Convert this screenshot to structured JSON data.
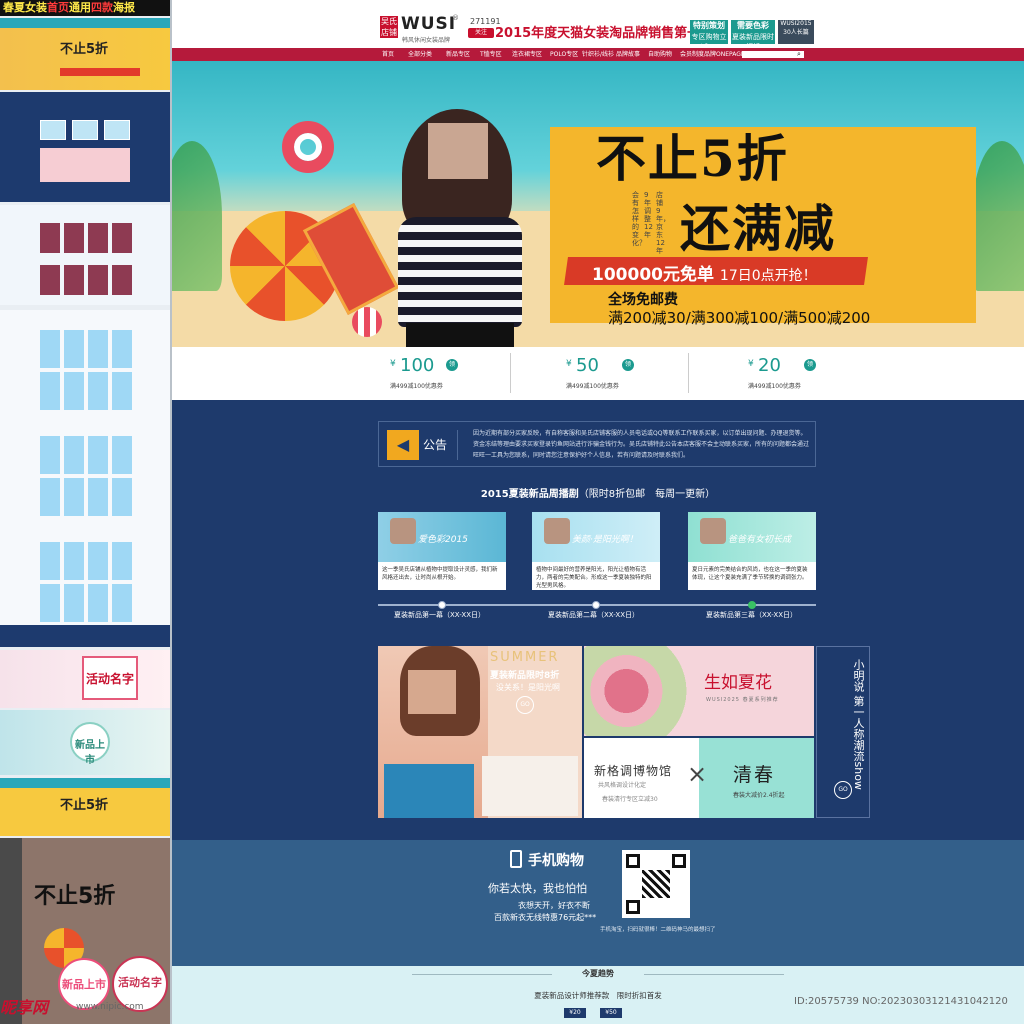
{
  "left_panel": {
    "title_parts": [
      "春夏女装",
      "首页",
      "通用",
      "四款",
      "海报"
    ],
    "hero_text": "不止5折",
    "promo1_label": "活动名字",
    "promo2_label": "新品上市",
    "ps_text": "不止5折",
    "ps_circle1": "新品上市",
    "ps_circle2": "活动名字"
  },
  "header": {
    "logo_badge": "吴氏店铺",
    "logo_text": "WUSI",
    "logo_sub": "韩风休闲女装品牌",
    "fav_count": "271191",
    "fav_button": "关注",
    "slogan": "2015年度天猫女装淘品牌销售第一",
    "box1_title": "特别策划",
    "box1_sub": "专区购物立减10",
    "box2_title": "需要色彩",
    "box2_sub": "夏装新品限时打折",
    "box3": "WUSI2015 30人长篇"
  },
  "nav": {
    "items": [
      "首页",
      "全部分类",
      "新品专区",
      "T恤专区",
      "连衣裙专区",
      "POLO专区",
      "针织衫/线衫",
      "品牌故事",
      "自助购物",
      "会员制度",
      "品牌ONEPAGE"
    ]
  },
  "hero": {
    "title1": "不止5折",
    "title2": "还满减",
    "vert1": "店铺9年，京东12年",
    "vert2": "9年调整12年",
    "vert3": "会有怎样的变化？",
    "free_main": "100000元免单",
    "free_sub": "17日0点开抢！",
    "line1": "全场免邮费",
    "line2": "满200减30/满300减100/满500减200"
  },
  "coupons": [
    {
      "currency": "¥",
      "amount": "100",
      "tag": "领",
      "condition": "满499减100优惠券"
    },
    {
      "currency": "¥",
      "amount": "50",
      "tag": "领",
      "condition": "满499减100优惠券"
    },
    {
      "currency": "¥",
      "amount": "20",
      "tag": "领",
      "condition": "满499减100优惠券"
    }
  ],
  "notice": {
    "label": "公告",
    "text": "因为近期有部分买家反映，有自称客服和吴氏店铺客服的人员电话或QQ等联系工作联系买家，以订单出现问题、办理退货等。资金冻结等理由要求买家登录钓鱼网站进行诈骗金钱行为。吴氏店铺特此公告本店客服不会主动联系买家，所有的问题都会通过旺旺一工具为您联系，同时请您注意保护好个人信息，若有问题请及时联系我们。"
  },
  "weekly": {
    "title": "2015夏装新品周播剧",
    "subtitle": "（限时8折包邮　每周一更新）",
    "cards": [
      {
        "caption": "爱色彩2015",
        "desc": "这一季吴氏店铺从植物中提取设计灵感，我们新风格还出去，让时尚从根开始。"
      },
      {
        "caption": "美颜·是阳光啊！",
        "desc": "植物中间最好的营养是阳光，阳光让植物有活力，两者的完美配合。形成这一季夏装独特的阳光型男风格。"
      },
      {
        "caption": "爸爸有女初长成",
        "desc": "夏日元素的完美结合的风尚，也在这一季的夏装体现，让这个夏装充满了季节转换的调调张力。"
      }
    ],
    "timeline": [
      "夏装新品第一幕（XX-XX日）",
      "夏装新品第二幕（XX-XX日）",
      "夏装新品第三幕（XX-XX日）"
    ]
  },
  "promos": {
    "a_summer": "SUMMER",
    "a_title": "夏装新品限时8折",
    "a_sub": "没关系！是阳光啊",
    "a_go": "GO",
    "b_title": "生如夏花",
    "b_sub": "WUSI2025 春夏系列推荐",
    "c_title": "新格调博物馆",
    "c_sub1": "共风格调设计化定",
    "c_sub2": "春装清行专区立减30",
    "d_title": "清春",
    "d_sub": "春装大减价2.4折起",
    "e_title": "小明说 第一人称潮流show",
    "e_go": "GO"
  },
  "mobile": {
    "title": "手机购物",
    "line1": "你若太快，我也怕怕",
    "line2": "衣想天开，好衣不断",
    "line3": "百款新衣无线特惠76元起***",
    "foot": "手机淘宝，扫码就很棒！二维码神马的最想扫了"
  },
  "trend": {
    "title": "今夏趋势",
    "sub": "夏装新品设计师推荐款　限时折扣首发",
    "btn1": "¥20",
    "btn2": "¥50"
  },
  "watermark": {
    "brand": "昵享网",
    "url": "www.nipic.com",
    "id": "ID:20575739 NO:20230303121431042120"
  }
}
